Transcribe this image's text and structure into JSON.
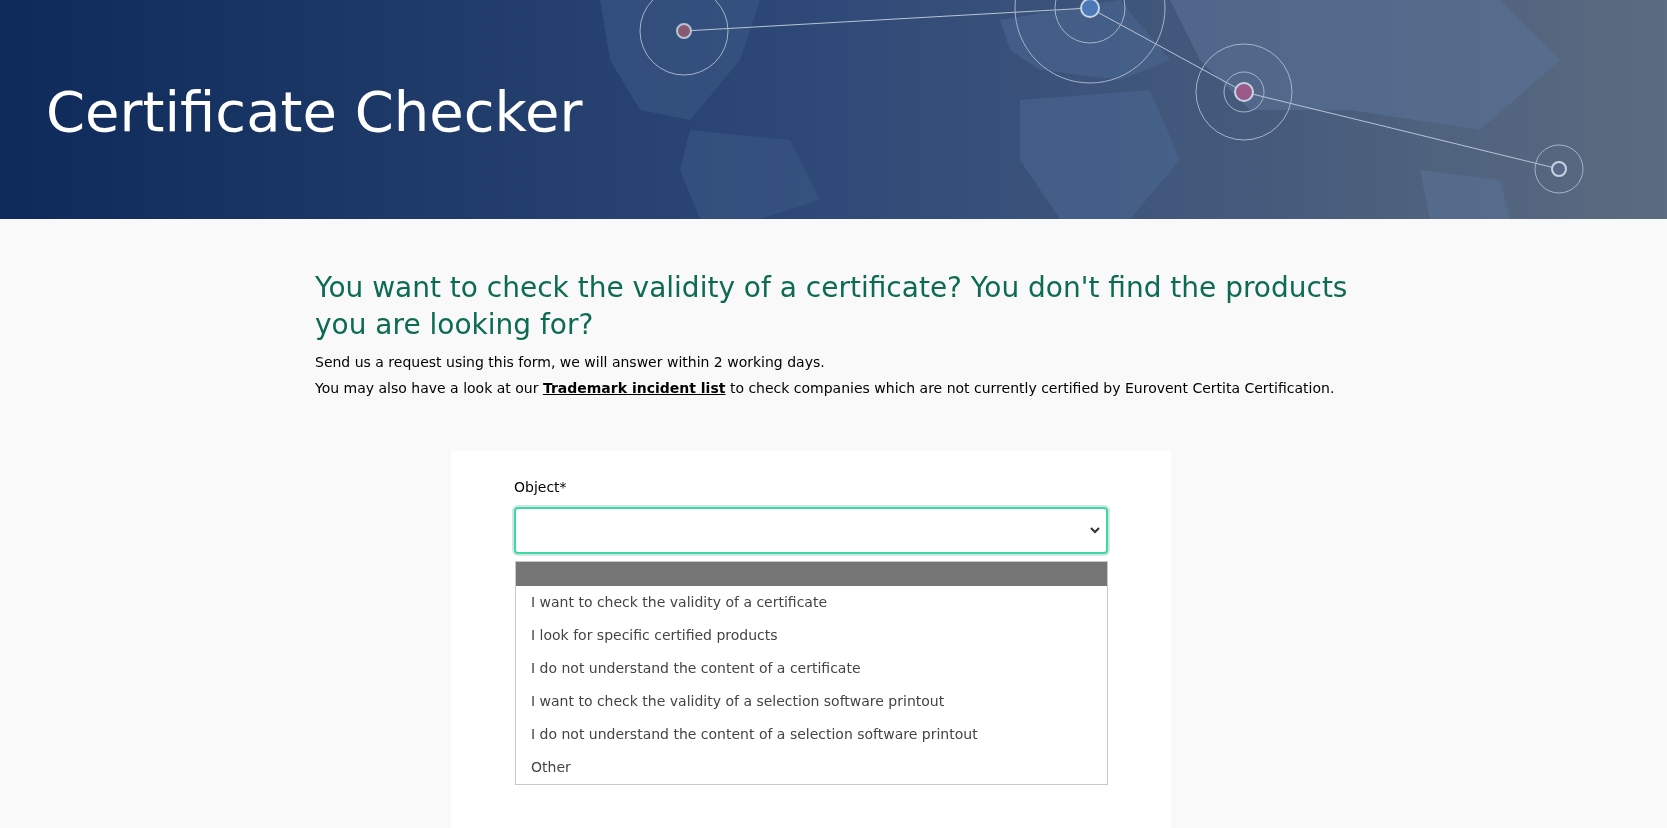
{
  "header": {
    "title": "Certificate Checker",
    "kind": "picture"
  },
  "intro": {
    "heading": "You want to check the validity of a certificate? You don't find the products you are looking for?",
    "line_1": "Send us a request using this form, we will answer within 2 working days.",
    "line_2_before": "You may also have a look at our ",
    "link": "Trademark incident list",
    "line_2_after": " to check companies which are not currently certified by Eurovent Certita Certification."
  },
  "form": {
    "object_label": "Object*",
    "object_select": {
      "focused": true,
      "expanded": true,
      "options": [
        {
          "selected": true
        },
        {
          "label": "I want to check the validity of a certificate",
          "selected": false
        },
        {
          "label": "I look for specific certified products",
          "selected": false
        },
        {
          "label": "I do not understand the content of a certificate",
          "selected": false
        },
        {
          "label": "I want to check the validity of a selection software printout",
          "selected": false
        },
        {
          "label": "I do not understand the content of a selection software printout",
          "selected": false
        },
        {
          "label": "Other",
          "selected": false
        }
      ]
    }
  }
}
